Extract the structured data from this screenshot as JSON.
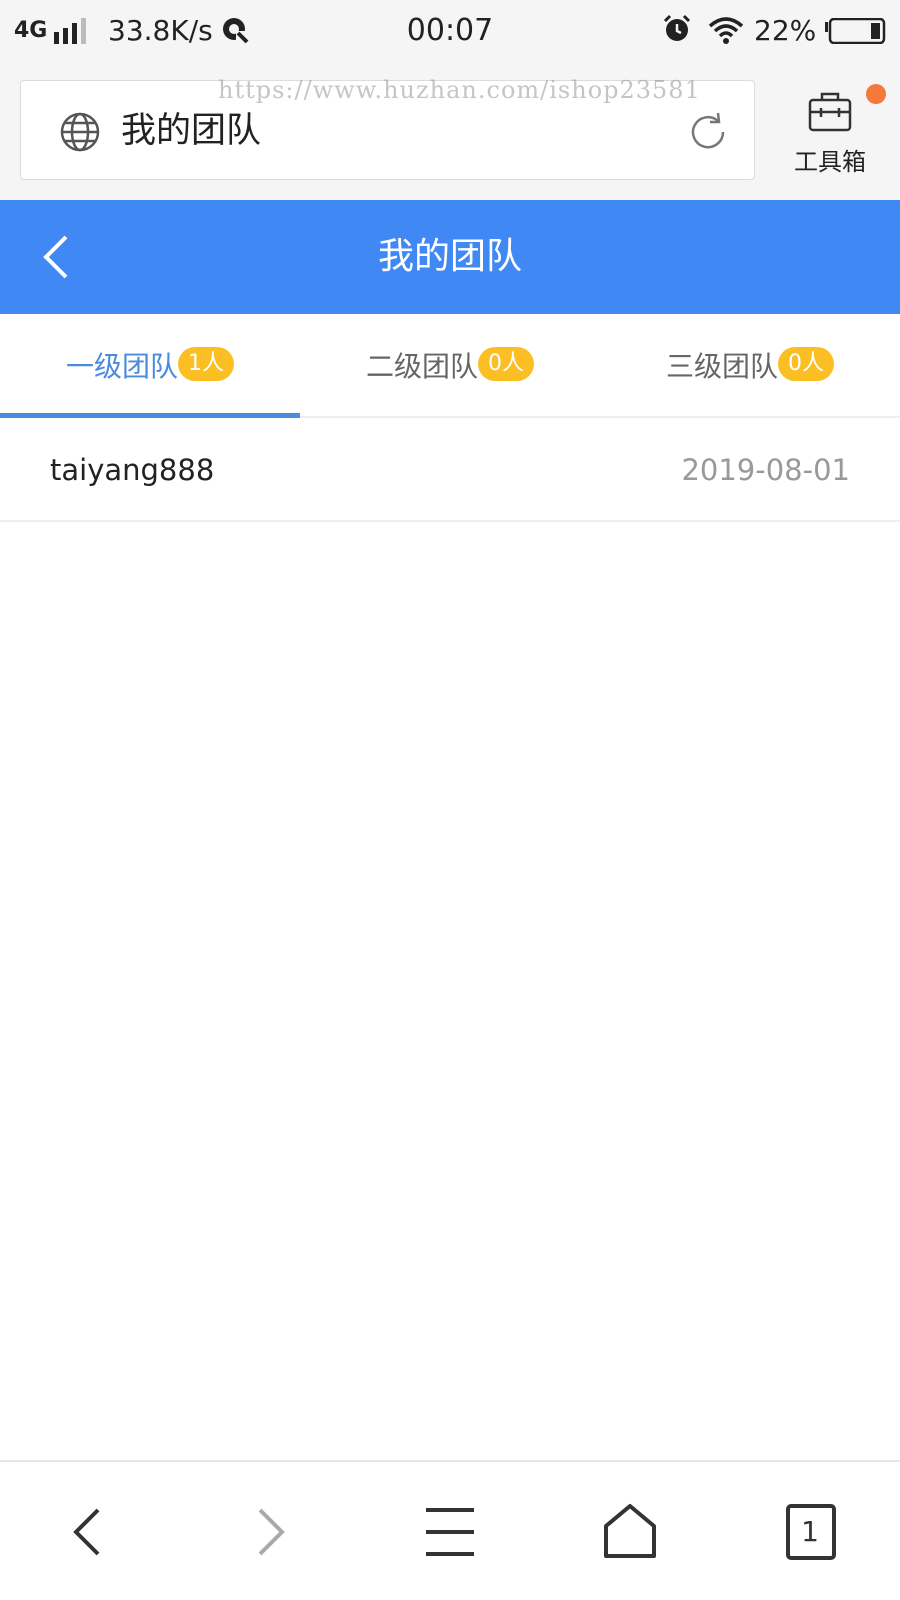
{
  "status_bar": {
    "network": "4G",
    "speed": "33.8K/s",
    "time": "00:07",
    "battery": "22%"
  },
  "browser": {
    "address_text": "我的团队",
    "watermark": "https://www.huzhan.com/ishop23581",
    "toolbox_label": "工具箱"
  },
  "header": {
    "title": "我的团队"
  },
  "tabs": [
    {
      "label": "一级团队",
      "count": "1人",
      "active": true
    },
    {
      "label": "二级团队",
      "count": "0人",
      "active": false
    },
    {
      "label": "三级团队",
      "count": "0人",
      "active": false
    }
  ],
  "members": [
    {
      "name": "taiyang888",
      "date": "2019-08-01"
    }
  ],
  "bottom_nav": {
    "tab_count": "1"
  },
  "colors": {
    "brand": "#4088f4",
    "tab_active": "#4a8be0",
    "badge": "#fbbf24",
    "notify_dot": "#f4793a"
  },
  "icons": {
    "back": "chevron-left-icon",
    "forward": "chevron-right-icon",
    "menu": "hamburger-icon",
    "home": "home-icon",
    "tabs": "tabs-icon",
    "globe": "globe-icon",
    "refresh": "refresh-icon",
    "toolbox": "toolbox-icon"
  }
}
